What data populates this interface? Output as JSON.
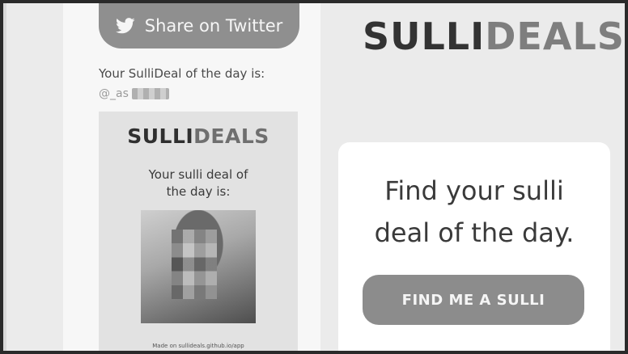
{
  "left": {
    "share_button_label": "Share on Twitter",
    "share_icon": "twitter-bird-icon",
    "result_text": "Your SulliDeal of the day is:",
    "handle_text": "@_as",
    "card": {
      "logo_primary": "SULLI",
      "logo_accent": "DEALS",
      "text_line1": "Your sulli deal of",
      "text_line2": "the day is:",
      "footer": "Made on sullideals.github.io/app"
    }
  },
  "right": {
    "brand_primary": "SULLI",
    "brand_accent": "DEALS",
    "hero_line1": "Find your sulli",
    "hero_line2": "deal of the day.",
    "cta_label": "FIND ME A SULLI"
  }
}
